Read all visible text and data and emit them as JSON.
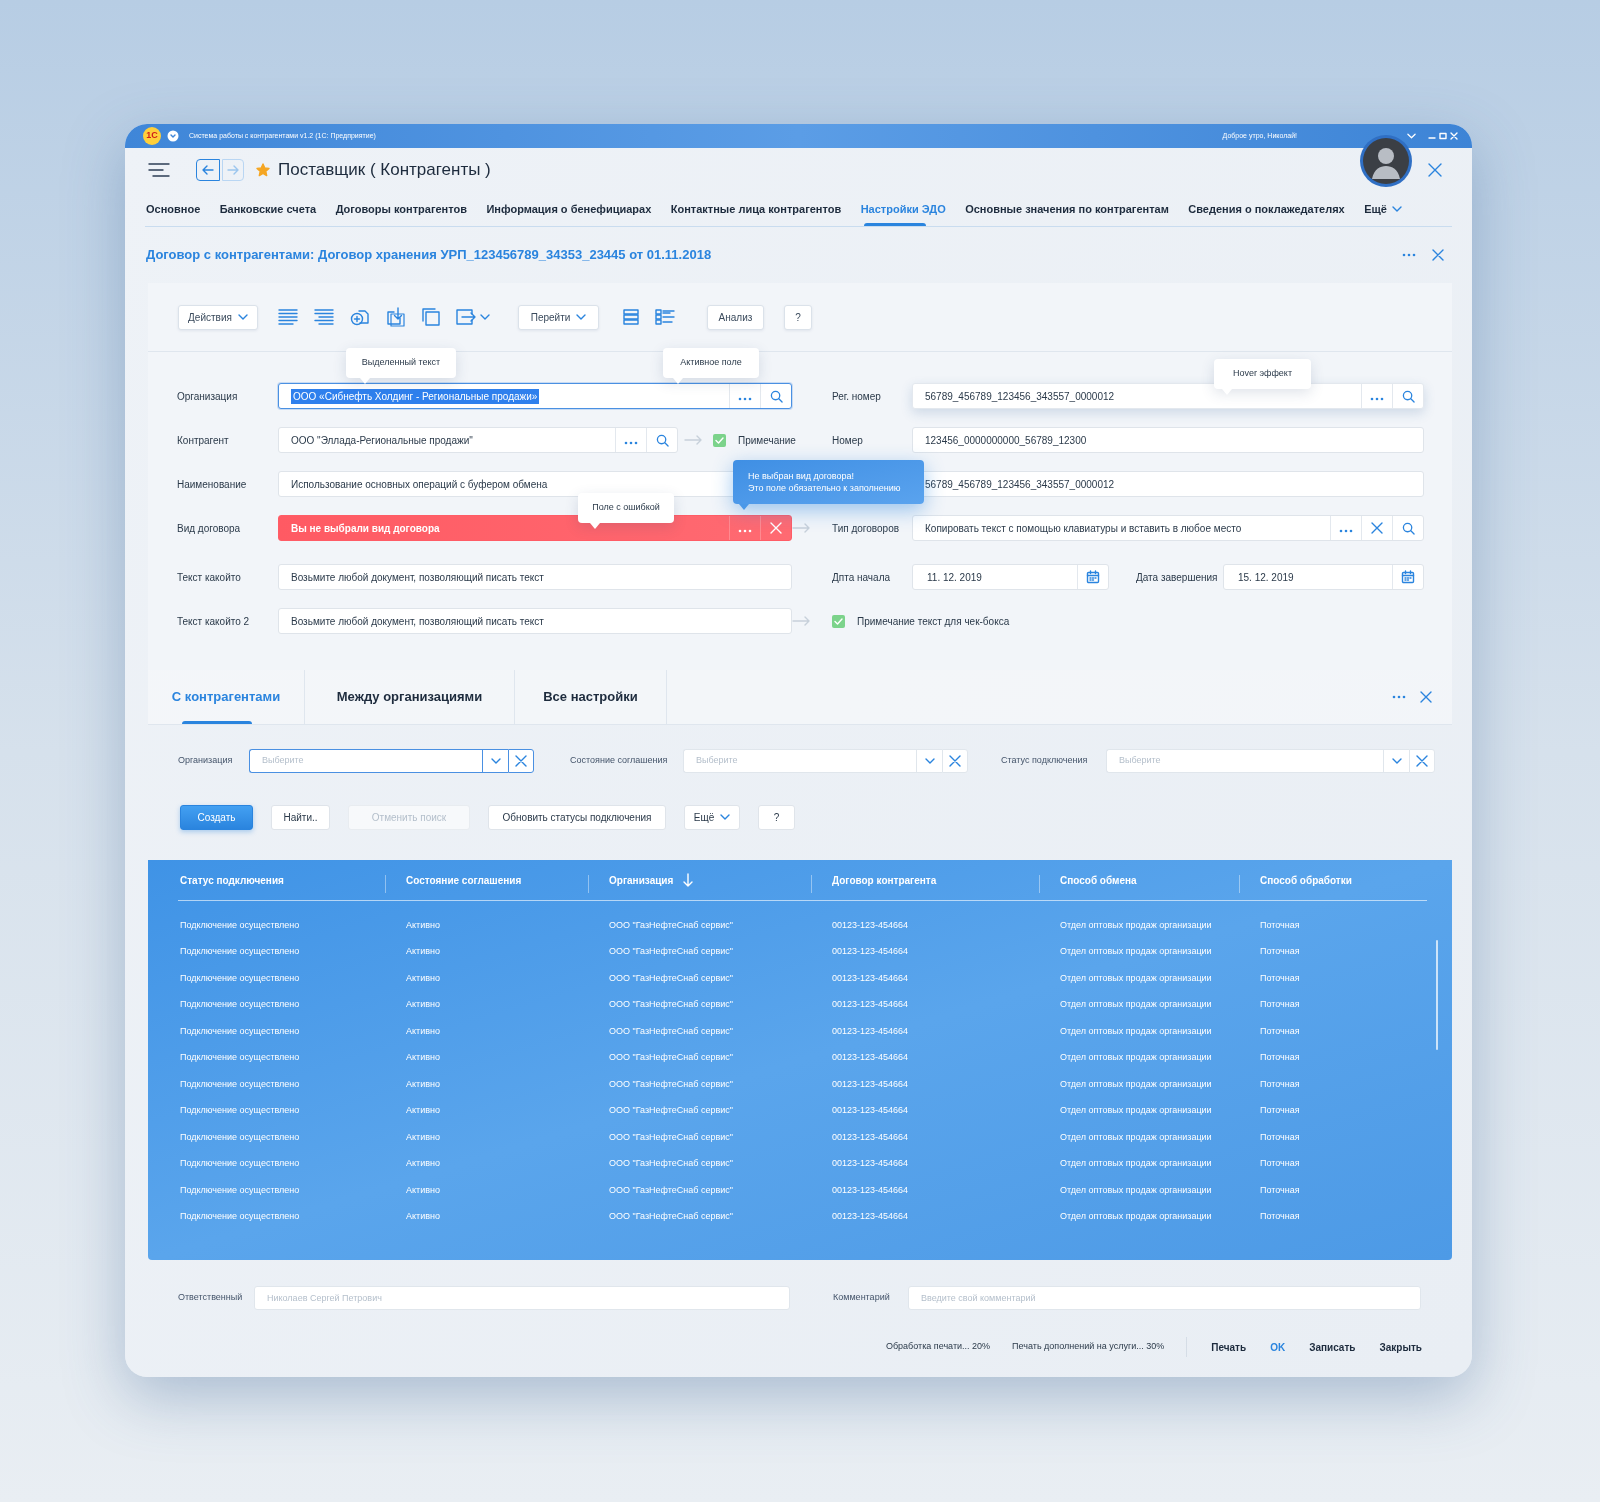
{
  "window": {
    "logo": "1С",
    "title": "Система работы с контрагентами v1.2 (1С: Предприятие)",
    "greeting": "Доброе утро, Николай!"
  },
  "header": {
    "title": "Поставщик ( Контрагенты )",
    "favorite": true,
    "back_enabled": true,
    "forward_enabled": false
  },
  "tabs": [
    {
      "label": "Основное",
      "selected": false,
      "kind": "tab"
    },
    {
      "label": "Банковские счета",
      "selected": false,
      "kind": "tab"
    },
    {
      "label": "Договоры контрагентов",
      "selected": false,
      "kind": "tab"
    },
    {
      "label": "Информация о бенефициарах",
      "selected": false,
      "kind": "tab"
    },
    {
      "label": "Контактные лица контрагентов",
      "selected": false,
      "kind": "tab"
    },
    {
      "label": "Настройки ЭДО",
      "selected": true,
      "kind": "tab"
    },
    {
      "label": "Основные значения по контрагентам",
      "selected": false,
      "kind": "tab"
    },
    {
      "label": "Сведения о поклажедателях",
      "selected": false,
      "kind": "tab"
    },
    {
      "label": "Ещё",
      "selected": false,
      "kind": "more"
    }
  ],
  "document": {
    "title": "Договор с контрагентами: Договор хранения УРП_123456789_34353_23445 от 01.11.2018"
  },
  "toolbar": {
    "actions": "Действия",
    "goto": "Перейти",
    "analysis": "Анализ",
    "help": "?"
  },
  "form": {
    "left": [
      {
        "label": "Организация",
        "value": "ООО «Сибнефть Холдинг - Региональные продажи»",
        "kind": "lookup",
        "active": true,
        "error": false,
        "text_selected": true
      },
      {
        "label": "Контрагент",
        "value": "ООО \"Эллада-Региональные продажи\"",
        "kind": "lookup",
        "active": false,
        "error": false,
        "text_selected": false,
        "note": {
          "label": "Примечание",
          "checked": true
        }
      },
      {
        "label": "Наименование",
        "value": "Использование основных операций с буфером обмена",
        "kind": "plain",
        "active": false,
        "error": false,
        "text_selected": false
      },
      {
        "label": "Вид договора",
        "value": "Вы не выбрали вид договора",
        "kind": "select",
        "active": false,
        "error": true,
        "text_selected": false
      },
      {
        "label": "Текст какойто",
        "value": "Возьмите любой документ, позволяющий писать текст",
        "kind": "plain",
        "active": false,
        "error": false,
        "text_selected": false
      },
      {
        "label": "Текст какойто 2",
        "value": "Возьмите любой документ, позволяющий писать текст",
        "kind": "plain",
        "active": false,
        "error": false,
        "text_selected": false
      }
    ],
    "right": [
      {
        "kind": "lookup",
        "label": "Рег. номер",
        "value": "56789_456789_123456_343557_0000012",
        "hovered": true,
        "linked": false
      },
      {
        "kind": "plain",
        "label": "Номер",
        "value": "123456_0000000000_56789_12300",
        "hovered": false,
        "linked": false
      },
      {
        "kind": "plain",
        "value": "56789_456789_123456_343557_0000012",
        "hovered": false
      },
      {
        "kind": "lookup_clear",
        "label": "Тип договоров",
        "value": "Копировать текст с помощью клавиатуры и вставить в любое место",
        "hovered": false,
        "linked": true
      },
      {
        "kind": "dates",
        "linked": false,
        "dates": [
          {
            "label": "Дпта начала",
            "value": "11. 12. 2019"
          },
          {
            "label": "Дата завершения",
            "value": "15. 12. 2019"
          }
        ]
      },
      {
        "kind": "checkbox",
        "label": "Примечание текст для чек-бокса",
        "checked": true,
        "linked": true
      }
    ]
  },
  "tooltips": [
    {
      "kind": "hint",
      "text": "Выделенный текст"
    },
    {
      "kind": "hint",
      "text": "Активное поле"
    },
    {
      "kind": "hint",
      "text": "Hover эффект"
    },
    {
      "kind": "hint",
      "text": "Поле с ошибкой"
    },
    {
      "kind": "error",
      "text": "Не выбран вид договора!\nЭто поле обязательно к заполнению"
    }
  ],
  "section": {
    "tabs": [
      {
        "label": "С контрагентами",
        "selected": true
      },
      {
        "label": "Между организациями",
        "selected": false
      },
      {
        "label": "Все настройки",
        "selected": false
      }
    ],
    "filters": [
      {
        "label": "Организация",
        "placeholder": "Выберите",
        "active": true
      },
      {
        "label": "Состояние соглашения",
        "placeholder": "Выберите",
        "active": false
      },
      {
        "label": "Статус подключения",
        "placeholder": "Выберите",
        "active": false
      }
    ],
    "buttons": [
      {
        "label": "Создать",
        "kind": "primary"
      },
      {
        "label": "Найти..",
        "kind": "default"
      },
      {
        "label": "Отменить поиск",
        "kind": "disabled"
      },
      {
        "label": "Обновить статусы подключения",
        "kind": "default"
      },
      {
        "label": "Ещё",
        "kind": "dropdown"
      },
      {
        "label": "?",
        "kind": "default"
      }
    ]
  },
  "table": {
    "columns": [
      {
        "label": "Статус подключения",
        "sorted": false
      },
      {
        "label": "Состояние соглашения",
        "sorted": false
      },
      {
        "label": "Организация",
        "sorted": true
      },
      {
        "label": "Договор контрагента",
        "sorted": false
      },
      {
        "label": "Способ обмена",
        "sorted": false
      },
      {
        "label": "Способ обработки",
        "sorted": false
      }
    ],
    "rows": [
      [
        "Подключение осуществлено",
        "Активно",
        "ООО \"ГазНефтеСнаб сервис\"",
        "00123-123-454664",
        "Отдел оптовых продаж организации",
        "Поточная"
      ],
      [
        "Подключение осуществлено",
        "Активно",
        "ООО \"ГазНефтеСнаб сервис\"",
        "00123-123-454664",
        "Отдел оптовых продаж организации",
        "Поточная"
      ],
      [
        "Подключение осуществлено",
        "Активно",
        "ООО \"ГазНефтеСнаб сервис\"",
        "00123-123-454664",
        "Отдел оптовых продаж организации",
        "Поточная"
      ],
      [
        "Подключение осуществлено",
        "Активно",
        "ООО \"ГазНефтеСнаб сервис\"",
        "00123-123-454664",
        "Отдел оптовых продаж организации",
        "Поточная"
      ],
      [
        "Подключение осуществлено",
        "Активно",
        "ООО \"ГазНефтеСнаб сервис\"",
        "00123-123-454664",
        "Отдел оптовых продаж организации",
        "Поточная"
      ],
      [
        "Подключение осуществлено",
        "Активно",
        "ООО \"ГазНефтеСнаб сервис\"",
        "00123-123-454664",
        "Отдел оптовых продаж организации",
        "Поточная"
      ],
      [
        "Подключение осуществлено",
        "Активно",
        "ООО \"ГазНефтеСнаб сервис\"",
        "00123-123-454664",
        "Отдел оптовых продаж организации",
        "Поточная"
      ],
      [
        "Подключение осуществлено",
        "Активно",
        "ООО \"ГазНефтеСнаб сервис\"",
        "00123-123-454664",
        "Отдел оптовых продаж организации",
        "Поточная"
      ],
      [
        "Подключение осуществлено",
        "Активно",
        "ООО \"ГазНефтеСнаб сервис\"",
        "00123-123-454664",
        "Отдел оптовых продаж организации",
        "Поточная"
      ],
      [
        "Подключение осуществлено",
        "Активно",
        "ООО \"ГазНефтеСнаб сервис\"",
        "00123-123-454664",
        "Отдел оптовых продаж организации",
        "Поточная"
      ],
      [
        "Подключение осуществлено",
        "Активно",
        "ООО \"ГазНефтеСнаб сервис\"",
        "00123-123-454664",
        "Отдел оптовых продаж организации",
        "Поточная"
      ],
      [
        "Подключение осуществлено",
        "Активно",
        "ООО \"ГазНефтеСнаб сервис\"",
        "00123-123-454664",
        "Отдел оптовых продаж организации",
        "Поточная"
      ]
    ]
  },
  "footer": {
    "fields": [
      {
        "label": "Ответственный",
        "placeholder": "Николаев Сергей Петрович"
      },
      {
        "label": "Комментарий",
        "placeholder": "Введите свой комментарий"
      }
    ],
    "progress": [
      "Обработка печати... 20%",
      "Печать дополнений на услуги... 30%"
    ],
    "buttons": [
      {
        "label": "Печать",
        "kind": "default"
      },
      {
        "label": "OK",
        "kind": "primary"
      },
      {
        "label": "Записать",
        "kind": "default"
      },
      {
        "label": "Закрыть",
        "kind": "default"
      }
    ]
  }
}
